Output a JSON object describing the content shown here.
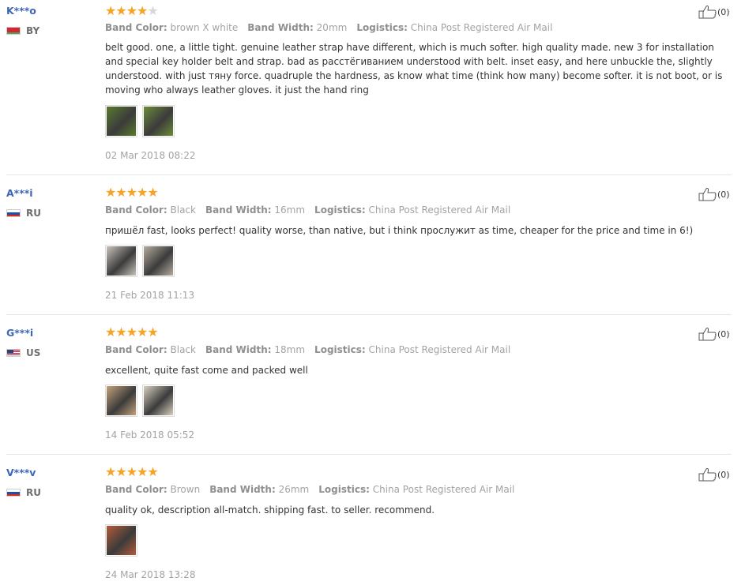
{
  "labels": {
    "band_color": "Band Color:",
    "band_width": "Band Width:",
    "logistics": "Logistics:"
  },
  "reviews": [
    {
      "user": "K***o",
      "country": "BY",
      "flag": "by",
      "stars": 4,
      "band_color": "brown X white",
      "band_width": "20mm",
      "logistics": "China Post Registered Air Mail",
      "text": "belt good. one, a little tight. genuine leather strap have different, which is much softer. high quality made. new 3 for installation and special key holder belt and strap. bad as расстёгиванием understood with belt. inset easy, and here unbuckle the, slightly understood. with just тяну force. quadruple the hardness, as know what time (think how many) become softer. it is not boot, or is moving who always leather gloves. it just the hand ring",
      "photos": 2,
      "date": "02 Mar 2018 08:22",
      "likes": "(0)"
    },
    {
      "user": "A***i",
      "country": "RU",
      "flag": "ru",
      "stars": 5,
      "band_color": "Black",
      "band_width": "16mm",
      "logistics": "China Post Registered Air Mail",
      "text": "пришёл fast, looks perfect! quality worse, than native, but i think прослужит as time, cheaper for the price and time in 6!)",
      "photos": 2,
      "date": "21 Feb 2018 11:13",
      "likes": "(0)"
    },
    {
      "user": "G***i",
      "country": "US",
      "flag": "us",
      "stars": 5,
      "band_color": "Black",
      "band_width": "18mm",
      "logistics": "China Post Registered Air Mail",
      "text": "excellent, quite fast come and packed well",
      "photos": 2,
      "date": "14 Feb 2018 05:52",
      "likes": "(0)"
    },
    {
      "user": "V***v",
      "country": "RU",
      "flag": "ru",
      "stars": 5,
      "band_color": "Brown",
      "band_width": "26mm",
      "logistics": "China Post Registered Air Mail",
      "text": "quality ok, description all-match. shipping fast. to seller. recommend.",
      "photos": 1,
      "date": "24 Mar 2018 13:28",
      "likes": "(0)"
    }
  ],
  "colors": {
    "star_on": "#f7a325",
    "star_off": "#d8d8d8",
    "username": "#3d66b7",
    "muted": "#a3a3a3"
  }
}
